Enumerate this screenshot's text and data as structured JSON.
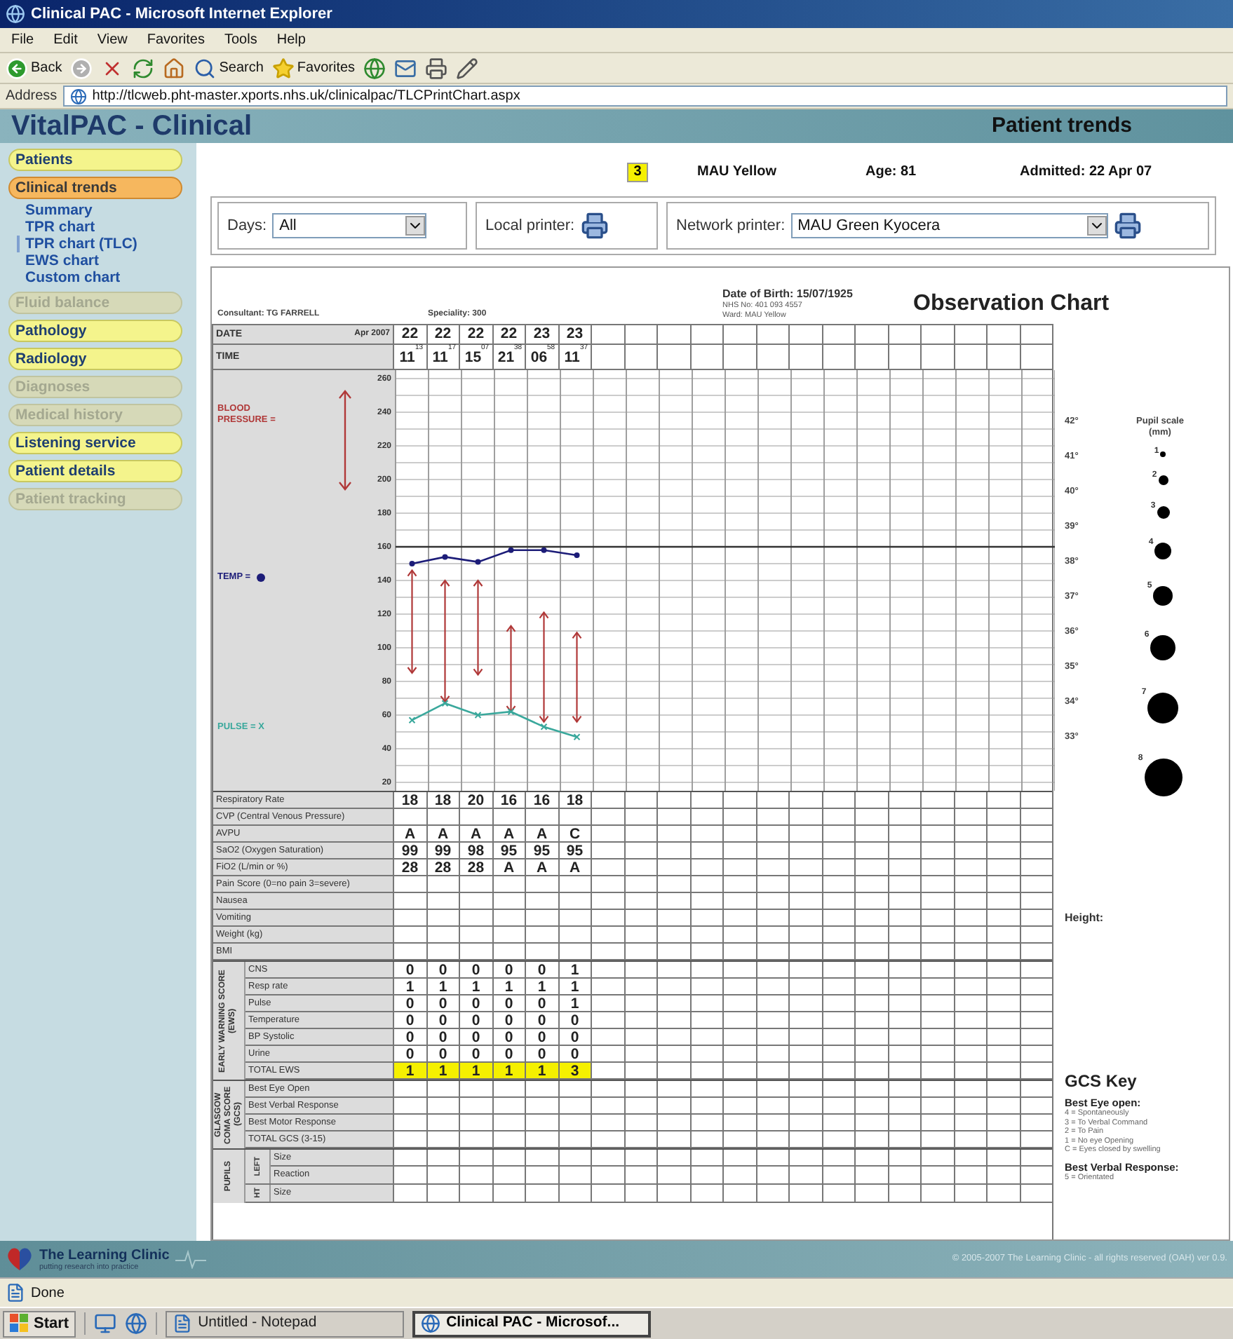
{
  "window": {
    "title": "Clinical PAC - Microsoft Internet Explorer"
  },
  "menu": [
    "File",
    "Edit",
    "View",
    "Favorites",
    "Tools",
    "Help"
  ],
  "toolbar": [
    {
      "kind": "back",
      "label": "Back"
    },
    {
      "kind": "forward"
    },
    {
      "kind": "stop"
    },
    {
      "kind": "refresh"
    },
    {
      "kind": "home"
    },
    {
      "kind": "search",
      "label": "Search"
    },
    {
      "kind": "favorites",
      "label": "Favorites"
    },
    {
      "kind": "media"
    },
    {
      "kind": "mail"
    },
    {
      "kind": "print"
    },
    {
      "kind": "edit"
    }
  ],
  "address": {
    "label": "Address",
    "url": "http://tlcweb.pht-master.xports.nhs.uk/clinicalpac/TLCPrintChart.aspx"
  },
  "app": {
    "title": "VitalPAC - Clinical",
    "page_title": "Patient trends"
  },
  "sidebar": {
    "items": [
      {
        "label": "Patients",
        "selected": false,
        "disabled": false
      },
      {
        "label": "Clinical trends",
        "selected": true,
        "disabled": false,
        "children": [
          {
            "label": "Summary",
            "selected": false
          },
          {
            "label": "TPR chart",
            "selected": false
          },
          {
            "label": "TPR chart (TLC)",
            "selected": true
          },
          {
            "label": "EWS chart",
            "selected": false
          },
          {
            "label": "Custom chart",
            "selected": false
          }
        ]
      },
      {
        "label": "Fluid balance",
        "selected": false,
        "disabled": true
      },
      {
        "label": "Pathology",
        "selected": false,
        "disabled": false
      },
      {
        "label": "Radiology",
        "selected": false,
        "disabled": false
      },
      {
        "label": "Diagnoses",
        "selected": false,
        "disabled": true
      },
      {
        "label": "Medical history",
        "selected": false,
        "disabled": true
      },
      {
        "label": "Listening service",
        "selected": false,
        "disabled": false
      },
      {
        "label": "Patient details",
        "selected": false,
        "disabled": false
      },
      {
        "label": "Patient tracking",
        "selected": false,
        "disabled": true
      }
    ]
  },
  "patient": {
    "ews": "3",
    "ward": "MAU Yellow",
    "age": "Age: 81",
    "admitted": "Admitted: 22 Apr 07"
  },
  "controls": {
    "days": {
      "label": "Days:",
      "value": "All"
    },
    "local_printer": {
      "label": "Local printer:"
    },
    "network_printer": {
      "label": "Network printer:",
      "value": "MAU Green Kyocera"
    }
  },
  "chart": {
    "consultant": "Consultant: TG FARRELL",
    "speciality": "Speciality: 300",
    "dob": "Date of Birth: 15/07/1925",
    "nhs": "NHS No: 401 093 4557",
    "ward": "Ward: MAU Yellow",
    "title": "Observation Chart",
    "date_row": {
      "label": "DATE",
      "month": "Apr 2007",
      "values": [
        "22",
        "22",
        "22",
        "22",
        "23",
        "23"
      ]
    },
    "time_row": {
      "label": "TIME",
      "values": [
        {
          "hour": "11",
          "minute": "13"
        },
        {
          "hour": "11",
          "minute": "17"
        },
        {
          "hour": "15",
          "minute": "07"
        },
        {
          "hour": "21",
          "minute": "38"
        },
        {
          "hour": "06",
          "minute": "58"
        },
        {
          "hour": "11",
          "minute": "37"
        }
      ]
    },
    "chart_data": {
      "type": "line",
      "categories": [
        null,
        null,
        null,
        null,
        null,
        null,
        null,
        null,
        null,
        null,
        null,
        null,
        null,
        null,
        null,
        null,
        null,
        null,
        null,
        null
      ],
      "ylim": [
        20,
        260
      ],
      "yticks": [
        260,
        240,
        220,
        200,
        180,
        160,
        140,
        120,
        100,
        80,
        60,
        40,
        20
      ],
      "grid": true,
      "ref_lines": [
        {
          "axis": "y",
          "value": 160
        }
      ],
      "series": [
        {
          "name": "TEMP =",
          "color": "#1c1c78",
          "marker": "o",
          "values": [
            150,
            154,
            151,
            158,
            158,
            155,
            null,
            null,
            null,
            null,
            null,
            null,
            null,
            null,
            null,
            null,
            null,
            null,
            null,
            null
          ]
        },
        {
          "name": "PULSE = X",
          "color": "#3aa89c",
          "marker": "x",
          "values": [
            57,
            67,
            60,
            62,
            53,
            47,
            null,
            null,
            null,
            null,
            null,
            null,
            null,
            null,
            null,
            null,
            null,
            null,
            null,
            null
          ]
        }
      ]
    },
    "bp_label": "BLOOD PRESSURE =",
    "observations": [
      {
        "label": "Respiratory Rate",
        "values": [
          "18",
          "18",
          "20",
          "16",
          "16",
          "18"
        ]
      },
      {
        "label": "CVP (Central Venous Pressure)"
      },
      {
        "label": "AVPU",
        "values": [
          "A",
          "A",
          "A",
          "A",
          "A",
          "C"
        ]
      },
      {
        "label": "SaO2 (Oxygen Saturation)",
        "values": [
          "99",
          "99",
          "98",
          "95",
          "95",
          "95"
        ]
      },
      {
        "label": "FiO2 (L/min or %)",
        "values": [
          "28",
          "28",
          "28",
          "A",
          "A",
          "A"
        ]
      },
      {
        "label": "Pain Score (0=no pain 3=severe)"
      },
      {
        "label": "Nausea"
      },
      {
        "label": "Vomiting"
      },
      {
        "label": "Weight (kg)"
      },
      {
        "label": "BMI"
      }
    ],
    "groups": [
      {
        "label": "EARLY WARNING SCORE (EWS)",
        "rows": [
          {
            "label": "CNS",
            "values": [
              "0",
              "0",
              "0",
              "0",
              "0",
              "1"
            ],
            "highlight": false
          },
          {
            "label": "Resp rate",
            "values": [
              "1",
              "1",
              "1",
              "1",
              "1",
              "1"
            ],
            "highlight": false
          },
          {
            "label": "Pulse",
            "values": [
              "0",
              "0",
              "0",
              "0",
              "0",
              "1"
            ],
            "highlight": false
          },
          {
            "label": "Temperature",
            "values": [
              "0",
              "0",
              "0",
              "0",
              "0",
              "0"
            ],
            "highlight": false
          },
          {
            "label": "BP Systolic",
            "values": [
              "0",
              "0",
              "0",
              "0",
              "0",
              "0"
            ],
            "highlight": false
          },
          {
            "label": "Urine",
            "values": [
              "0",
              "0",
              "0",
              "0",
              "0",
              "0"
            ],
            "highlight": false
          },
          {
            "label": "TOTAL EWS",
            "values": [
              "1",
              "1",
              "1",
              "1",
              "1",
              "3"
            ],
            "highlight": true
          }
        ]
      },
      {
        "label": "GLASGOW COMA SCORE (GCS)",
        "rows": [
          {
            "label": "Best Eye Open"
          },
          {
            "label": "Best Verbal Response"
          },
          {
            "label": "Best Motor Response"
          },
          {
            "label": "TOTAL GCS (3-15)"
          }
        ]
      }
    ],
    "pupils": {
      "label": "PUPILS",
      "sides": [
        {
          "label": "LEFT",
          "rows": [
            "Size",
            "Reaction"
          ]
        },
        {
          "label": "HT",
          "rows": [
            "Size"
          ]
        }
      ]
    },
    "temp_scale": [
      "42°",
      "41°",
      "40°",
      "39°",
      "38°",
      "37°",
      "36°",
      "35°",
      "34°",
      "33°"
    ],
    "pupil_scale": {
      "title": "Pupil scale (mm)",
      "sizes": [
        "1",
        "2",
        "3",
        "4",
        "5",
        "6",
        "7",
        "8"
      ]
    },
    "height_label": "Height:",
    "gcs_key": {
      "title": "GCS Key",
      "sections": [
        {
          "heading": "Best Eye open:",
          "items": [
            "4 = Spontaneously",
            "3 = To Verbal Command",
            "2 = To Pain",
            "1 = No eye Opening",
            "C = Eyes closed by swelling"
          ]
        },
        {
          "heading": "Best Verbal Response:",
          "items": [
            "5 = Orientated"
          ]
        }
      ]
    }
  },
  "footer": {
    "brand": "The Learning Clinic",
    "tagline": "putting research into practice",
    "copyright": "© 2005-2007 The Learning Clinic - all rights reserved (OAH) ver 0.9."
  },
  "status_bar": {
    "text": "Done"
  },
  "taskbar": {
    "start": "Start",
    "tasks": [
      {
        "label": "Untitled - Notepad",
        "selected": false
      },
      {
        "label": "Clinical PAC - Microsof...",
        "selected": true
      }
    ]
  }
}
